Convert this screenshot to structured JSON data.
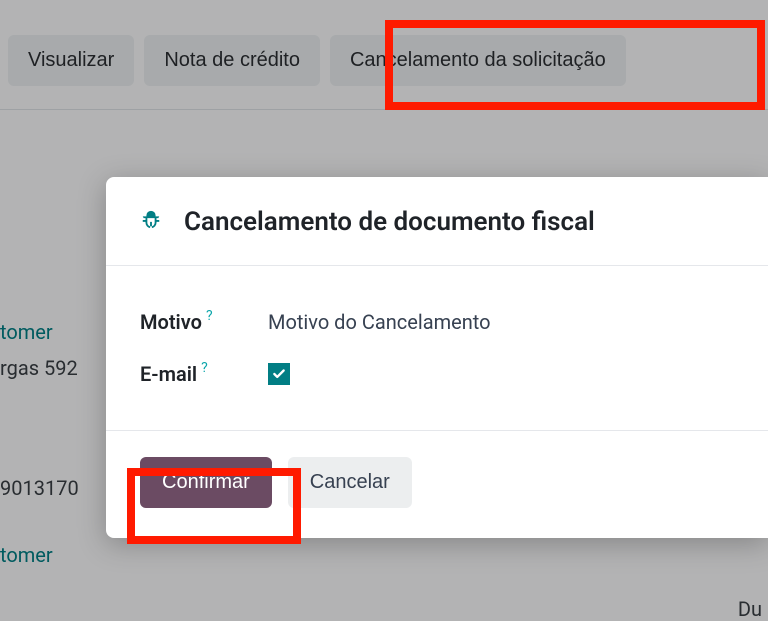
{
  "toolbar": {
    "visualizar": "Visualizar",
    "nota_credito": "Nota de crédito",
    "cancelamento_solicitacao": "Cancelamento da solicitação"
  },
  "background": {
    "tomer1": "tomer",
    "rgas": "rgas 592",
    "num": "9013170",
    "tomer2": "tomer",
    "du_fragment": "Du"
  },
  "modal": {
    "title": "Cancelamento de documento fiscal",
    "motivo_label": "Motivo",
    "motivo_value": "Motivo do Cancelamento",
    "email_label": "E-mail",
    "email_checked": true,
    "confirm": "Confirmar",
    "cancel": "Cancelar"
  }
}
